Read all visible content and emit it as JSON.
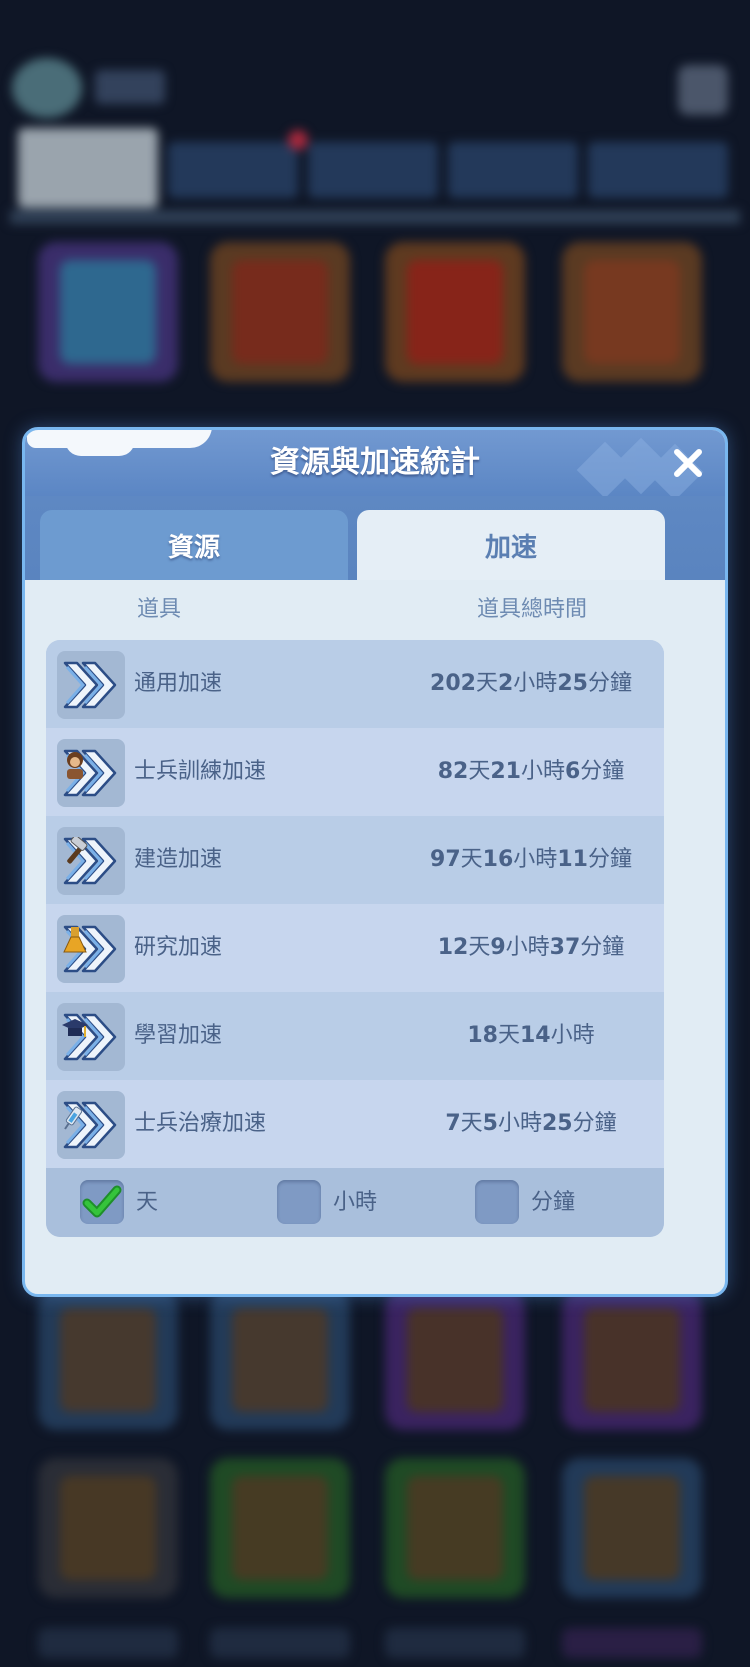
{
  "modal": {
    "title": "資源與加速統計",
    "tabs": {
      "resources": "資源",
      "speedups": "加速"
    },
    "active_tab": "speedups",
    "columns": {
      "item": "道具",
      "total_time": "道具總時間"
    }
  },
  "items": [
    {
      "name": "通用加速",
      "badge": "none",
      "time": [
        {
          "n": "202",
          "u": "天"
        },
        {
          "n": "2",
          "u": "小時"
        },
        {
          "n": "25",
          "u": "分鐘"
        }
      ]
    },
    {
      "name": "士兵訓練加速",
      "badge": "soldier-icon",
      "time": [
        {
          "n": "82",
          "u": "天"
        },
        {
          "n": "21",
          "u": "小時"
        },
        {
          "n": "6",
          "u": "分鐘"
        }
      ]
    },
    {
      "name": "建造加速",
      "badge": "hammer-icon",
      "time": [
        {
          "n": "97",
          "u": "天"
        },
        {
          "n": "16",
          "u": "小時"
        },
        {
          "n": "11",
          "u": "分鐘"
        }
      ]
    },
    {
      "name": "研究加速",
      "badge": "flask-icon",
      "time": [
        {
          "n": "12",
          "u": "天"
        },
        {
          "n": "9",
          "u": "小時"
        },
        {
          "n": "37",
          "u": "分鐘"
        }
      ]
    },
    {
      "name": "學習加速",
      "badge": "graduation-cap-icon",
      "time": [
        {
          "n": "18",
          "u": "天"
        },
        {
          "n": "14",
          "u": "小時"
        }
      ]
    },
    {
      "name": "士兵治療加速",
      "badge": "syringe-icon",
      "time": [
        {
          "n": "7",
          "u": "天"
        },
        {
          "n": "5",
          "u": "小時"
        },
        {
          "n": "25",
          "u": "分鐘"
        }
      ]
    }
  ],
  "filters": [
    {
      "label": "天",
      "checked": true
    },
    {
      "label": "小時",
      "checked": false
    },
    {
      "label": "分鐘",
      "checked": false
    }
  ],
  "colors": {
    "header": "#5b86c4",
    "row_odd": "#b9cde7",
    "row_even": "#c7d6ee",
    "text": "#4a6288",
    "check_green": "#35c43b"
  }
}
